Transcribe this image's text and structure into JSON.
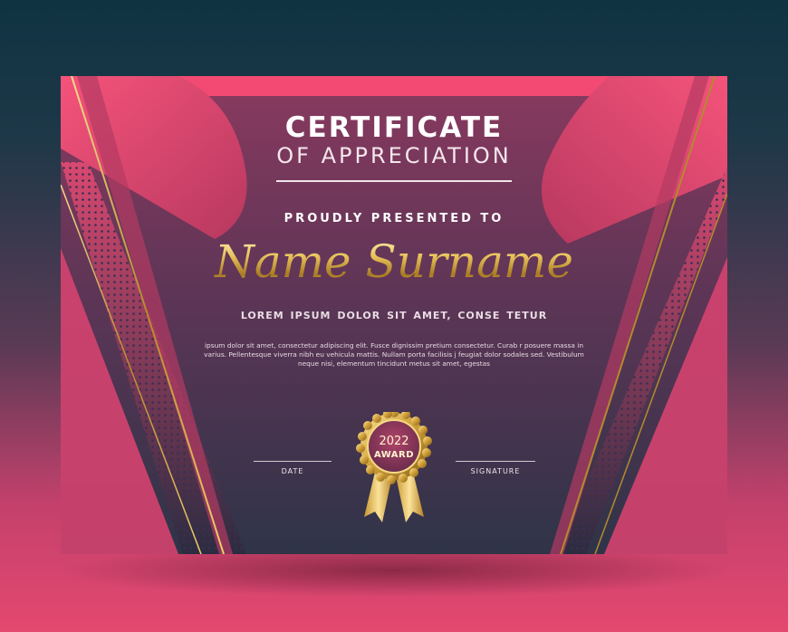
{
  "certificate": {
    "title_line1": "CERTIFICATE",
    "title_line2": "OF APPRECIATION",
    "presented": "PROUDLY PRESENTED TO",
    "name": "Name Surname",
    "subtitle": "LOREM IPSUM DOLOR SIT AMET, CONSE  TETUR",
    "body": "ipsum dolor sit amet, consectetur adipiscing elit. Fusce dignissim pretium consectetur. Curab r posuere massa in varius. Pellentesque viverra nibh eu vehicula mattis. Nullam porta facilisis j feugiat dolor sodales sed. Vestibulum neque nisi, elementum tincidunt metus sit amet, egestas",
    "date_label": "DATE",
    "signature_label": "SIGNATURE",
    "medal": {
      "year": "2022",
      "label": "AWARD",
      "icon": "award-medal-icon"
    }
  },
  "colors": {
    "pink": "#f0456e",
    "gold": "#d8b04a",
    "plum": "#5e3556",
    "navy": "#2f3448"
  }
}
